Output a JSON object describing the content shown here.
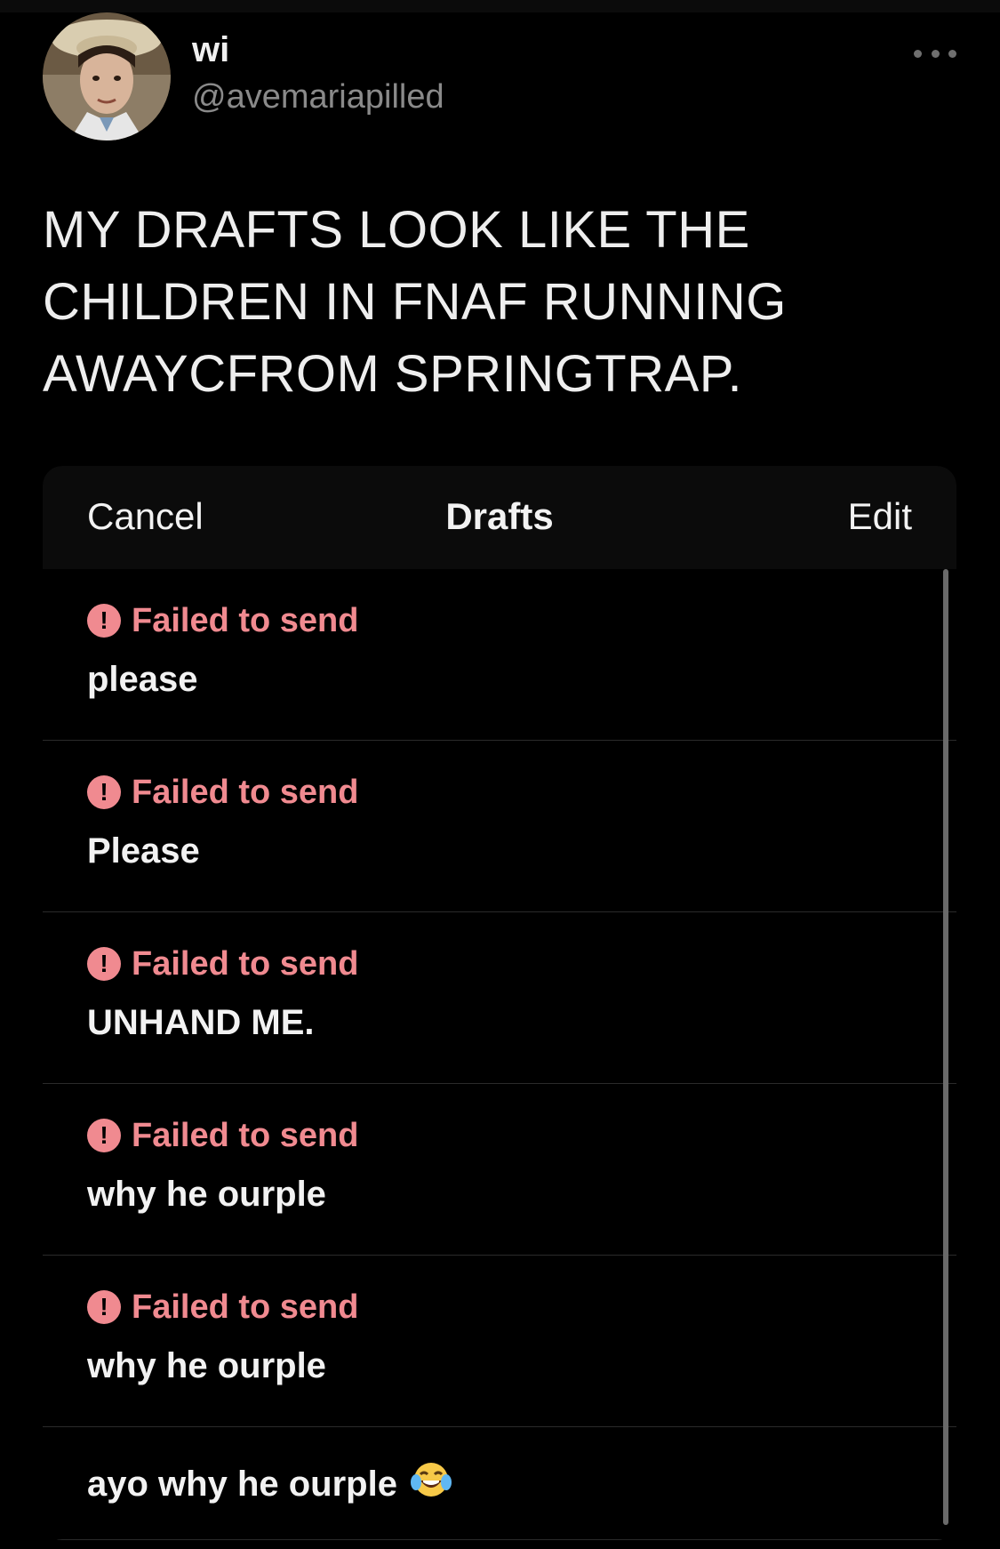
{
  "tweet": {
    "author": {
      "display_name": "wi",
      "handle": "@avemariapilled",
      "avatar_icon": "profile-photo"
    },
    "more_icon": "more-dots-icon",
    "text": "MY DRAFTS LOOK LIKE THE CHILDREN IN FNAF RUNNING AWAYCFROM SPRINGTRAP."
  },
  "drafts_screen": {
    "header": {
      "cancel_label": "Cancel",
      "title": "Drafts",
      "edit_label": "Edit"
    },
    "items": [
      {
        "status": "Failed to send",
        "text": "please"
      },
      {
        "status": "Failed to send",
        "text": "Please"
      },
      {
        "status": "Failed to send",
        "text": "UNHAND ME."
      },
      {
        "status": "Failed to send",
        "text": "why he ourple"
      },
      {
        "status": "Failed to send",
        "text": "why he ourple"
      },
      {
        "status": "",
        "text": "ayo why he ourple",
        "emoji": "tears-of-joy-emoji"
      }
    ]
  },
  "colors": {
    "background": "#000000",
    "failed_status": "#f08a90",
    "handle_gray": "#8a8a8a",
    "text_primary": "#f2f2f2"
  }
}
